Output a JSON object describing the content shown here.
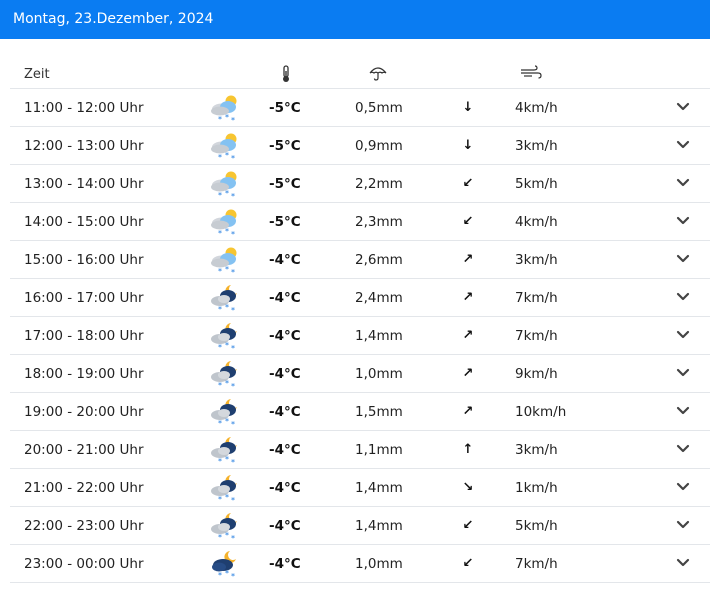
{
  "header": {
    "date": "Montag, 23.Dezember, 2024"
  },
  "columns": {
    "time_label": "Zeit",
    "temp_icon": "thermometer-icon",
    "rain_icon": "umbrella-icon",
    "wind_icon": "wind-icon"
  },
  "colors": {
    "header_bg": "#0a7cf2",
    "divider": "#e3e6ea"
  },
  "rows": [
    {
      "time": "11:00 - 12:00 Uhr",
      "icon": "day-partly-cloudy-snow-icon",
      "temp": "-5°C",
      "precip": "0,5mm",
      "wind_dir": "↓",
      "wind_speed": "4km/h"
    },
    {
      "time": "12:00 - 13:00 Uhr",
      "icon": "day-partly-cloudy-snow-icon",
      "temp": "-5°C",
      "precip": "0,9mm",
      "wind_dir": "↓",
      "wind_speed": "3km/h"
    },
    {
      "time": "13:00 - 14:00 Uhr",
      "icon": "day-partly-cloudy-snow-icon",
      "temp": "-5°C",
      "precip": "2,2mm",
      "wind_dir": "↙",
      "wind_speed": "5km/h"
    },
    {
      "time": "14:00 - 15:00 Uhr",
      "icon": "day-partly-cloudy-snow-icon",
      "temp": "-5°C",
      "precip": "2,3mm",
      "wind_dir": "↙",
      "wind_speed": "4km/h"
    },
    {
      "time": "15:00 - 16:00 Uhr",
      "icon": "day-partly-cloudy-snow-icon",
      "temp": "-4°C",
      "precip": "2,6mm",
      "wind_dir": "↗",
      "wind_speed": "3km/h"
    },
    {
      "time": "16:00 - 17:00 Uhr",
      "icon": "night-partly-cloudy-snow-icon",
      "temp": "-4°C",
      "precip": "2,4mm",
      "wind_dir": "↗",
      "wind_speed": "7km/h"
    },
    {
      "time": "17:00 - 18:00 Uhr",
      "icon": "night-partly-cloudy-snow-icon",
      "temp": "-4°C",
      "precip": "1,4mm",
      "wind_dir": "↗",
      "wind_speed": "7km/h"
    },
    {
      "time": "18:00 - 19:00 Uhr",
      "icon": "night-partly-cloudy-snow-icon",
      "temp": "-4°C",
      "precip": "1,0mm",
      "wind_dir": "↗",
      "wind_speed": "9km/h"
    },
    {
      "time": "19:00 - 20:00 Uhr",
      "icon": "night-partly-cloudy-snow-icon",
      "temp": "-4°C",
      "precip": "1,5mm",
      "wind_dir": "↗",
      "wind_speed": "10km/h"
    },
    {
      "time": "20:00 - 21:00 Uhr",
      "icon": "night-partly-cloudy-snow-icon",
      "temp": "-4°C",
      "precip": "1,1mm",
      "wind_dir": "↑",
      "wind_speed": "3km/h"
    },
    {
      "time": "21:00 - 22:00 Uhr",
      "icon": "night-partly-cloudy-snow-icon",
      "temp": "-4°C",
      "precip": "1,4mm",
      "wind_dir": "↘",
      "wind_speed": "1km/h"
    },
    {
      "time": "22:00 - 23:00 Uhr",
      "icon": "night-partly-cloudy-snow-icon",
      "temp": "-4°C",
      "precip": "1,4mm",
      "wind_dir": "↙",
      "wind_speed": "5km/h"
    },
    {
      "time": "23:00 - 00:00 Uhr",
      "icon": "night-cloudy-snow-icon",
      "temp": "-4°C",
      "precip": "1,0mm",
      "wind_dir": "↙",
      "wind_speed": "7km/h"
    }
  ]
}
